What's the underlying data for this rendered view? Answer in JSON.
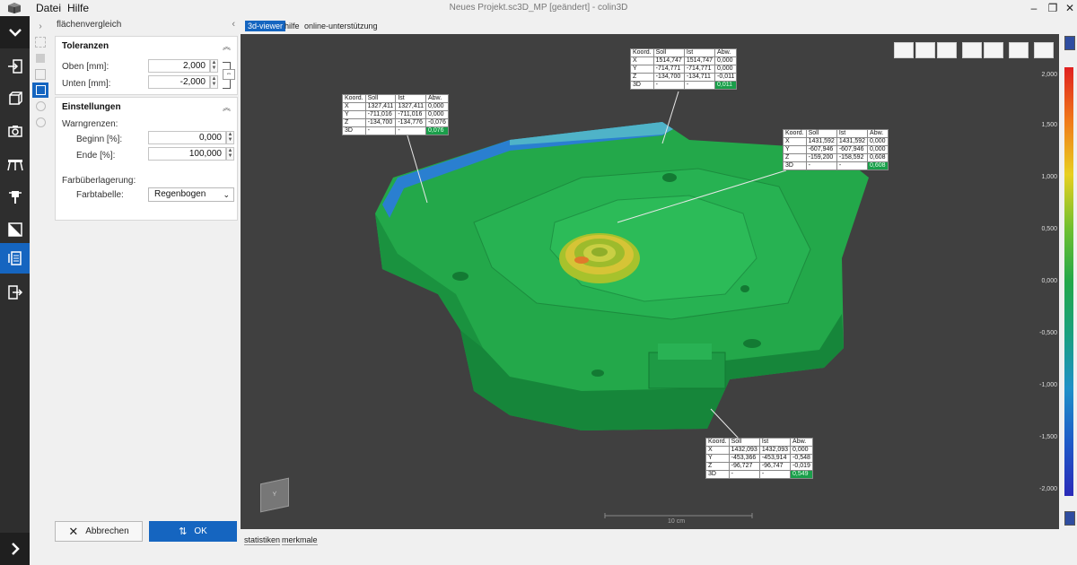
{
  "window": {
    "title": "Neues Projekt.sc3D_MP [geändert] - colin3D",
    "menu": [
      "Datei",
      "Hilfe"
    ]
  },
  "panel": {
    "header": "flächenvergleich",
    "toleranzen": {
      "title": "Toleranzen",
      "oben_label": "Oben [mm]:",
      "oben_value": "2,000",
      "unten_label": "Unten [mm]:",
      "unten_value": "-2,000"
    },
    "einstellungen": {
      "title": "Einstellungen",
      "warngrenzen_label": "Warngrenzen:",
      "beginn_label": "Beginn [%]:",
      "beginn_value": "0,000",
      "ende_label": "Ende [%]:",
      "ende_value": "100,000",
      "farbueberlagerung_label": "Farbüberlagerung:",
      "farbtabelle_label": "Farbtabelle:",
      "farbtabelle_value": "Regenbogen"
    },
    "cancel_label": "Abbrechen",
    "ok_label": "OK"
  },
  "viewer": {
    "tabs": [
      "3d-viewer",
      "hilfe",
      "online-unterstützung"
    ],
    "bottom_tabs": [
      "statistiken",
      "merkmale"
    ],
    "scale_label": "10 cm",
    "colors": {
      "accent": "#1565c0",
      "mesh": "#23a84a",
      "viewport_bg": "#404040"
    }
  },
  "scale": {
    "labels": [
      "2,000",
      "1,500",
      "1,000",
      "0,500",
      "0,000",
      "-0,500",
      "-1,000",
      "-1,500",
      "-2,000"
    ]
  },
  "callouts": [
    {
      "headers": [
        "Koord.",
        "Soll",
        "Ist",
        "Abw."
      ],
      "rows": [
        [
          "X",
          "1327,411",
          "1327,411",
          "0,000"
        ],
        [
          "Y",
          "-711,016",
          "-711,016",
          "0,000"
        ],
        [
          "Z",
          "-134,700",
          "-134,776",
          "-0,076"
        ],
        [
          "3D",
          "-",
          "-",
          "0,076"
        ]
      ]
    },
    {
      "headers": [
        "Koord.",
        "Soll",
        "Ist",
        "Abw."
      ],
      "rows": [
        [
          "X",
          "1514,747",
          "1514,747",
          "0,000"
        ],
        [
          "Y",
          "-714,771",
          "-714,771",
          "0,000"
        ],
        [
          "Z",
          "-134,700",
          "-134,711",
          "-0,011"
        ],
        [
          "3D",
          "-",
          "-",
          "0,011"
        ]
      ]
    },
    {
      "headers": [
        "Koord.",
        "Soll",
        "Ist",
        "Abw."
      ],
      "rows": [
        [
          "X",
          "1431,592",
          "1431,592",
          "0,000"
        ],
        [
          "Y",
          "-607,946",
          "-607,946",
          "0,000"
        ],
        [
          "Z",
          "-159,200",
          "-158,592",
          "0,608"
        ],
        [
          "3D",
          "-",
          "-",
          "0,608"
        ]
      ]
    },
    {
      "headers": [
        "Koord.",
        "Soll",
        "Ist",
        "Abw."
      ],
      "rows": [
        [
          "X",
          "1432,093",
          "1432,093",
          "0,000"
        ],
        [
          "Y",
          "-453,366",
          "-453,914",
          "-0,548"
        ],
        [
          "Z",
          "-96,727",
          "-96,747",
          "-0,019"
        ],
        [
          "3D",
          "-",
          "-",
          "0,549"
        ]
      ]
    }
  ],
  "icons": [
    "app-logo-icon",
    "chevron-down-icon",
    "import-icon",
    "cube-icon",
    "camera-icon",
    "scanner-icon",
    "probe-icon",
    "measure-icon",
    "report-icon",
    "export-icon",
    "chevron-right-icon",
    "close-icon",
    "ok-icon",
    "view-cube-icon"
  ]
}
